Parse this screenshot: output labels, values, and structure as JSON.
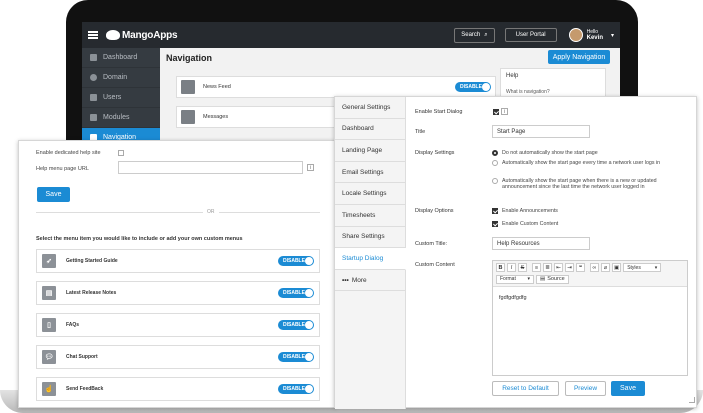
{
  "app": {
    "logo_text": "MangoApps",
    "search_label": "Search",
    "user_portal_label": "User Portal",
    "hello": "Hello",
    "user_name": "Kevin",
    "accent": "#1b8bd4"
  },
  "sidebar": {
    "items": [
      {
        "label": "Dashboard",
        "icon": "home-icon"
      },
      {
        "label": "Domain",
        "icon": "globe-icon"
      },
      {
        "label": "Users",
        "icon": "user-icon"
      },
      {
        "label": "Modules",
        "icon": "puzzle-icon"
      },
      {
        "label": "Navigation",
        "icon": "list-icon"
      }
    ]
  },
  "navigation": {
    "title": "Navigation",
    "apply_label": "Apply Navigation",
    "rows": [
      {
        "label": "News Feed",
        "toggle": "DISABLE"
      },
      {
        "label": "Messages"
      }
    ],
    "help": {
      "title": "Help",
      "question": "What is navigation?"
    }
  },
  "left_panel": {
    "dedicated_help_label": "Enable dedicated help site",
    "help_url_label": "Help menu page URL",
    "help_url_value": "",
    "save_label": "Save",
    "or_label": "OR",
    "menu_prompt": "Select the menu item you would like to include or add your own custom menus",
    "menu_items": [
      {
        "label": "Getting Started Guide",
        "toggle": "DISABLE",
        "icon": "rocket-icon"
      },
      {
        "label": "Latest Release Notes",
        "toggle": "DISABLE",
        "icon": "notes-icon"
      },
      {
        "label": "FAQs",
        "toggle": "DISABLE",
        "icon": "document-icon"
      },
      {
        "label": "Chat Support",
        "toggle": "DISABLE",
        "icon": "chat-icon"
      },
      {
        "label": "Send FeedBack",
        "toggle": "DISABLE",
        "icon": "thumbs-up-icon"
      }
    ]
  },
  "right_panel": {
    "tabs": [
      "General Settings",
      "Dashboard",
      "Landing Page",
      "Email Settings",
      "Locale Settings",
      "Timesheets",
      "Share Settings",
      "Startup Dialog",
      "More"
    ],
    "active_tab": "Startup Dialog",
    "enable_label": "Enable Start Dialog",
    "title_label": "Title",
    "title_value": "Start Page",
    "display_settings_label": "Display Settings",
    "display_settings_options": [
      "Do not automatically show the start page",
      "Automatically show the start page every time a network user logs in",
      "Automatically show the start page when there is a new or updated announcement since the last time the network user logged in"
    ],
    "display_options_label": "Display Options",
    "display_options": [
      "Enable Announcements",
      "Enable Custom Content"
    ],
    "custom_title_label": "Custom Title:",
    "custom_title_value": "Help Resources",
    "custom_content_label": "Custom Content",
    "editor": {
      "styles_label": "Styles",
      "format_label": "Format",
      "source_label": "Source",
      "content": "fgdfgdfgdfg"
    },
    "reset_label": "Reset to Default",
    "preview_label": "Preview",
    "save_label": "Save"
  }
}
